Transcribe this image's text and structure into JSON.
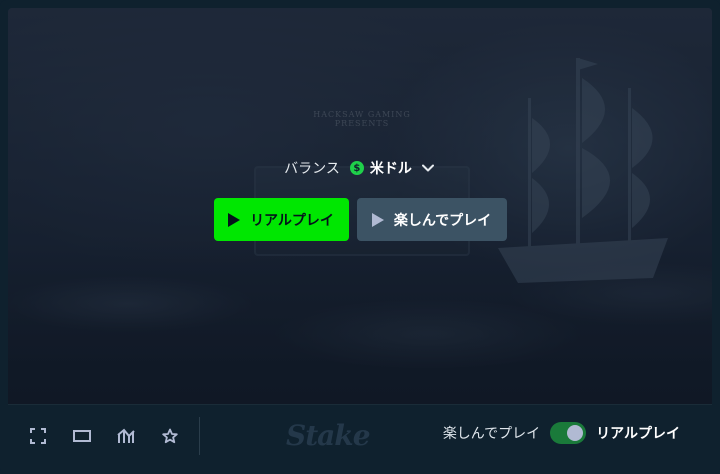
{
  "game": {
    "publisher_text": "HACKSAW GAMING PRESENTS"
  },
  "balance": {
    "label": "バランス",
    "coin_symbol": "$",
    "currency": "米ドル",
    "coin_color": "#1fd14a"
  },
  "buttons": {
    "real_play_label": "リアルプレイ",
    "fun_play_label": "楽しんでプレイ",
    "real_color": "#00e701",
    "fun_color": "#3c5364"
  },
  "toolbar": {
    "icons": [
      "fullscreen-icon",
      "theatre-mode-icon",
      "stats-icon",
      "favorite-icon"
    ],
    "brand": "Stake",
    "mode_fun_label": "楽しんでプレイ",
    "mode_real_label": "リアルプレイ",
    "mode_is_real": true
  }
}
